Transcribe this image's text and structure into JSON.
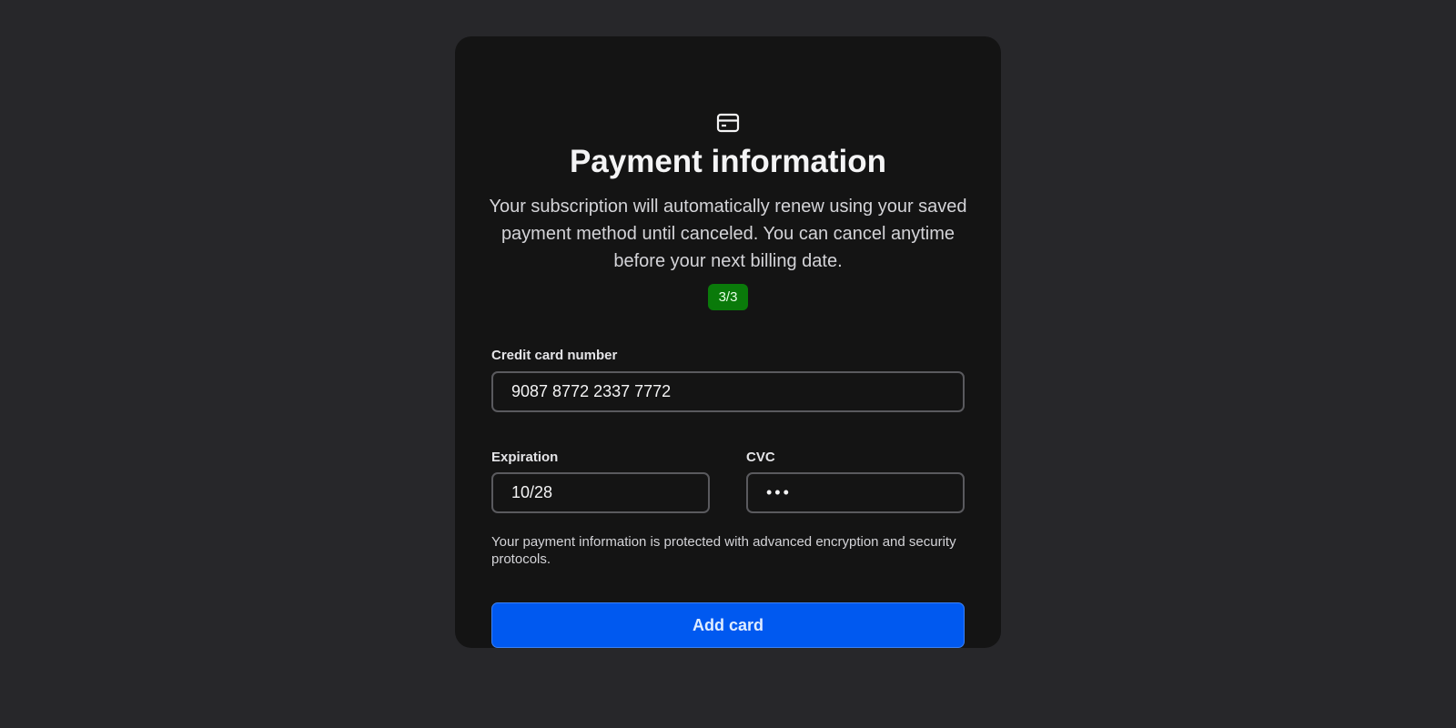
{
  "header": {
    "icon": "credit-card-icon",
    "title": "Payment information",
    "subtitle": "Your subscription will automatically renew using your saved payment method until canceled. You can cancel anytime before your next billing date.",
    "step_badge": "3/3"
  },
  "form": {
    "card_number": {
      "label": "Credit card number",
      "value": "9087 8772 2337 7772"
    },
    "expiration": {
      "label": "Expiration",
      "value": "10/28"
    },
    "cvc": {
      "label": "CVC",
      "value": "•••"
    },
    "security_note": "Your payment information is protected with advanced encryption and security protocols.",
    "submit_label": "Add card"
  },
  "colors": {
    "page_background": "#27272a",
    "card_background": "#141414",
    "badge_background": "#0a7a0a",
    "button_background": "#0059f0"
  }
}
